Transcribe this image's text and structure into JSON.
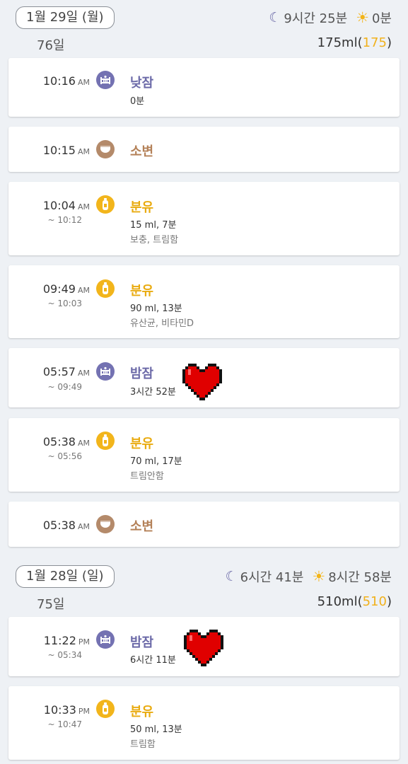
{
  "days": [
    {
      "date": "1월 29일 (월)",
      "age": "76일",
      "night_sleep": "9시간 25분",
      "day_sleep": "0분",
      "ml_total": "175ml",
      "ml_paren_num": "175",
      "entries": [
        {
          "time": "10:16",
          "ampm": "AM",
          "title": "낮잠",
          "detail": "0분",
          "icon": "crib-icon"
        },
        {
          "time": "10:15",
          "ampm": "AM",
          "title": "소변",
          "icon": "diaper-icon"
        },
        {
          "time": "10:04",
          "ampm": "AM",
          "end": "~ 10:12",
          "title": "분유",
          "detail": "15 ml, 7분",
          "memo": "보충, 트림함",
          "icon": "bottle-icon"
        },
        {
          "time": "09:49",
          "ampm": "AM",
          "end": "~ 10:03",
          "title": "분유",
          "detail": "90 ml, 13분",
          "memo": "유산균, 비타민D",
          "icon": "bottle-icon"
        },
        {
          "time": "05:57",
          "ampm": "AM",
          "end": "~ 09:49",
          "title": "밤잠",
          "detail": "3시간 52분",
          "icon": "crib-icon",
          "heart": true
        },
        {
          "time": "05:38",
          "ampm": "AM",
          "end": "~ 05:56",
          "title": "분유",
          "detail": "70 ml, 17분",
          "memo": "트림안함",
          "icon": "bottle-icon"
        },
        {
          "time": "05:38",
          "ampm": "AM",
          "title": "소변",
          "icon": "diaper-icon"
        }
      ]
    },
    {
      "date": "1월 28일 (일)",
      "age": "75일",
      "night_sleep": "6시간 41분",
      "day_sleep": "8시간 58분",
      "ml_total": "510ml",
      "ml_paren_num": "510",
      "entries": [
        {
          "time": "11:22",
          "ampm": "PM",
          "end": "~ 05:34",
          "title": "밤잠",
          "detail": "6시간 11분",
          "icon": "crib-icon",
          "heart": true
        },
        {
          "time": "10:33",
          "ampm": "PM",
          "end": "~ 10:47",
          "title": "분유",
          "detail": "50 ml, 13분",
          "memo": "트림함",
          "icon": "bottle-icon"
        }
      ]
    }
  ],
  "colors": {
    "sleep": "#7472b2",
    "diaper": "#b48a6a",
    "formula": "#f2b51b",
    "heart": "#e00000",
    "background": "#eef1f5"
  }
}
